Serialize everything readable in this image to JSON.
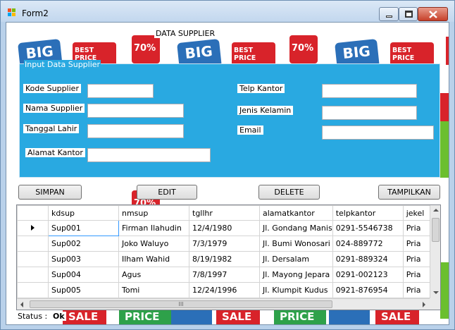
{
  "window": {
    "title": "Form2",
    "controls": [
      "minimize-icon",
      "maximize-icon",
      "close-icon"
    ]
  },
  "form": {
    "heading": "DATA SUPPLIER",
    "group_title": "Input Data Supplier",
    "fields": {
      "kode_supplier": {
        "label": "Kode Supplier",
        "value": ""
      },
      "nama_supplier": {
        "label": "Nama Supplier",
        "value": ""
      },
      "tanggal_lahir": {
        "label": "Tanggal Lahir",
        "value": ""
      },
      "alamat_kantor": {
        "label": "Alamat Kantor",
        "value": ""
      },
      "telp_kantor": {
        "label": "Telp Kantor",
        "value": ""
      },
      "jenis_kelamin": {
        "label": "Jenis Kelamin",
        "value": ""
      },
      "email": {
        "label": "Email",
        "value": ""
      }
    }
  },
  "buttons": {
    "simpan": "SIMPAN",
    "edit": "EDIT",
    "delete": "DELETE",
    "tampilkan": "TAMPILKAN"
  },
  "grid": {
    "columns": [
      "kdsup",
      "nmsup",
      "tgllhr",
      "alamatkantor",
      "telpkantor",
      "jekel"
    ],
    "rows": [
      [
        "Sup001",
        "Firman Ilahudin",
        "12/4/1980",
        "Jl. Gondang Manis",
        "0291-5546738",
        "Pria"
      ],
      [
        "Sup002",
        "Joko Waluyo",
        "7/3/1979",
        "Jl. Bumi Wonosari",
        "024-889772",
        "Pria"
      ],
      [
        "Sup003",
        "Ilham Wahid",
        "8/19/1982",
        "Jl. Dersalam",
        "0291-889324",
        "Pria"
      ],
      [
        "Sup004",
        "Agus",
        "7/8/1997",
        "Jl. Mayong Jepara",
        "0291-002123",
        "Pria"
      ],
      [
        "Sup005",
        "Tomi",
        "12/24/1996",
        "Jl. Klumpit Kudus",
        "0921-876954",
        "Pria"
      ]
    ],
    "current_row": 0,
    "scroll_grip": "III"
  },
  "status": {
    "label": "Status :",
    "value": "Ok"
  },
  "colors": {
    "group_background": "#29a9e1",
    "window_frame": "#b9d1ea",
    "close_button": "#c6402a"
  }
}
